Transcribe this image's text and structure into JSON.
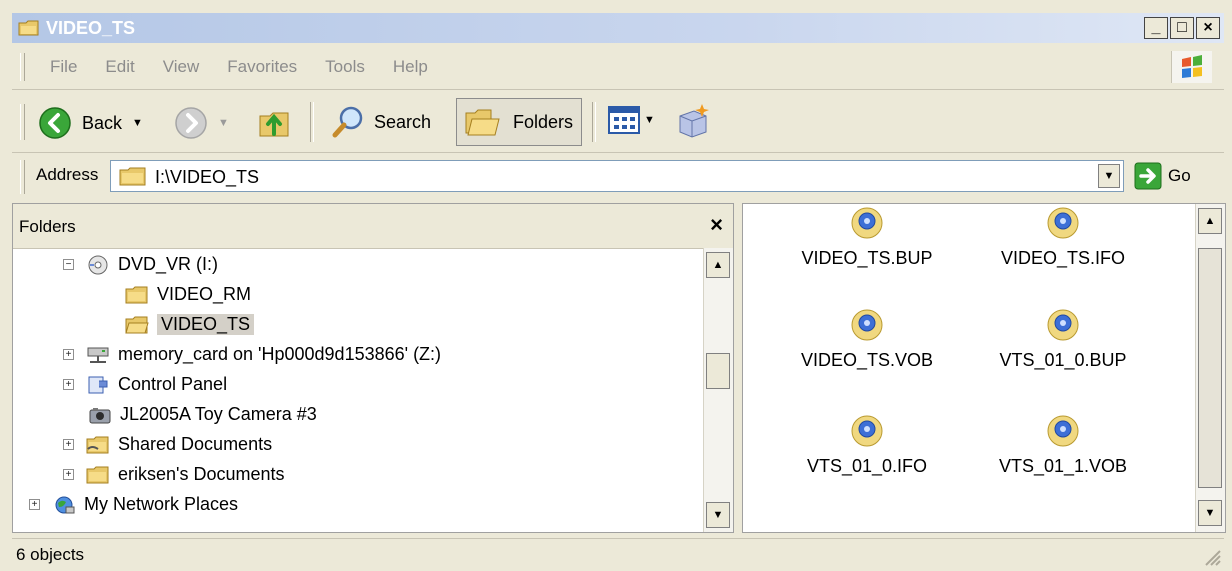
{
  "window": {
    "title": "VIDEO_TS",
    "minimize": "_",
    "maximize": "□",
    "close": "×"
  },
  "menu": {
    "items": [
      "File",
      "Edit",
      "View",
      "Favorites",
      "Tools",
      "Help"
    ]
  },
  "toolbar": {
    "back_label": "Back",
    "search_label": "Search",
    "folders_label": "Folders"
  },
  "address": {
    "label": "Address",
    "value": "I:\\VIDEO_TS",
    "go_label": "Go"
  },
  "folders_pane": {
    "title": "Folders",
    "close": "×",
    "tree": [
      {
        "label": "DVD_VR (I:)",
        "icon": "dvd-drive-icon",
        "expander": "−"
      },
      {
        "label": "VIDEO_RM",
        "icon": "folder-icon",
        "expander": ""
      },
      {
        "label": "VIDEO_TS",
        "icon": "folder-open-icon",
        "expander": "",
        "selected": true
      },
      {
        "label": "memory_card on 'Hp000d9d153866' (Z:)",
        "icon": "network-drive-icon",
        "expander": "+"
      },
      {
        "label": "Control Panel",
        "icon": "control-panel-icon",
        "expander": "+"
      },
      {
        "label": "JL2005A Toy Camera #3",
        "icon": "camera-icon",
        "expander": ""
      },
      {
        "label": "Shared Documents",
        "icon": "shared-folder-icon",
        "expander": "+"
      },
      {
        "label": "eriksen's Documents",
        "icon": "folder-icon",
        "expander": "+"
      },
      {
        "label": "My Network Places",
        "icon": "network-places-icon",
        "expander": "+"
      }
    ]
  },
  "files": [
    {
      "name": "VIDEO_TS.BUP"
    },
    {
      "name": "VIDEO_TS.IFO"
    },
    {
      "name": "VIDEO_TS.VOB"
    },
    {
      "name": "VTS_01_0.BUP"
    },
    {
      "name": "VTS_01_0.IFO"
    },
    {
      "name": "VTS_01_1.VOB"
    }
  ],
  "status": {
    "text": "6 objects"
  }
}
